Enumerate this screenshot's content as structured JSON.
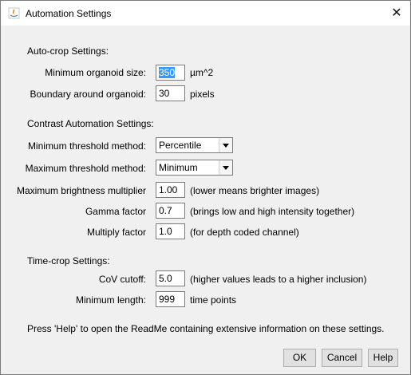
{
  "window": {
    "title": "Automation Settings",
    "close_glyph": "✕"
  },
  "autocrop": {
    "heading": "Auto-crop Settings:",
    "min_size_label": "Minimum organoid size:",
    "min_size_value": "350",
    "min_size_unit": "µm^2",
    "boundary_label": "Boundary around organoid:",
    "boundary_value": "30",
    "boundary_unit": "pixels"
  },
  "contrast": {
    "heading": "Contrast Automation Settings:",
    "min_method_label": "Minimum threshold method:",
    "min_method_value": "Percentile",
    "max_method_label": "Maximum threshold method:",
    "max_method_value": "Minimum",
    "brightness_label": "Maximum brightness multiplier",
    "brightness_value": "1.00",
    "brightness_hint": "(lower means brighter images)",
    "gamma_label": "Gamma factor",
    "gamma_value": "0.7",
    "gamma_hint": "(brings low and high intensity together)",
    "multiply_label": "Multiply factor",
    "multiply_value": "1.0",
    "multiply_hint": "(for depth coded channel)"
  },
  "timecrop": {
    "heading": "Time-crop Settings:",
    "cov_label": "CoV cutoff:",
    "cov_value": "5.0",
    "cov_hint": "(higher values leads to a higher inclusion)",
    "minlen_label": "Minimum length:",
    "minlen_value": "999",
    "minlen_unit": "time points"
  },
  "help_text": "Press 'Help' to open the ReadMe containing extensive information on these settings.",
  "buttons": {
    "ok": "OK",
    "cancel": "Cancel",
    "help": "Help"
  }
}
